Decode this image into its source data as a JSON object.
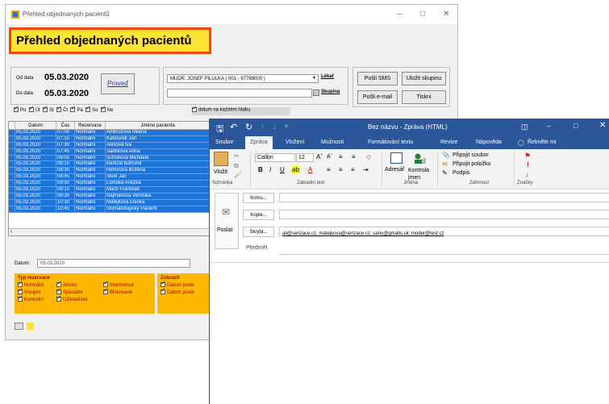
{
  "back_window": {
    "title": "Přehled objednaných pacientů",
    "heading": "Přehled objednaných pacientů",
    "od_data_label": "Od data",
    "od_data_value": "05.03.2020",
    "do_data_label": "Do data",
    "do_data_value": "05.03.2020",
    "proved_label": "Proveď",
    "doctor_value": "MUDR. JOSEF PILULKA ( 001 - 97789000 )",
    "lekar_label": "Lékař",
    "skupina_label": "Skupina",
    "posli_sms_label": "Pošli SMS",
    "ulozit_skupinu_label": "Uložit skupinu",
    "posli_email_label": "Pošli e-mail",
    "tisk_label": "Tiskni",
    "days": [
      "Po",
      "Út",
      "St",
      "Čt",
      "Pá",
      "So",
      "Ne"
    ],
    "datum_na_kazdem_label": "datum na každém řádku",
    "columns": [
      "Datum",
      "Čas",
      "Rezervace",
      "Jméno pacienta"
    ],
    "rows": [
      [
        "05.03.2020",
        "07:00",
        "Normální",
        "Ambrožová Milena"
      ],
      [
        "05.03.2020",
        "07:15",
        "Normální",
        "Kabourek Jan"
      ],
      [
        "05.03.2020",
        "07:30",
        "Normální",
        "Alexová Iva"
      ],
      [
        "05.03.2020",
        "07:45",
        "Normální",
        "Sadílková Anna"
      ],
      [
        "05.03.2020",
        "08:00",
        "Normální",
        "Schobová Michaela"
      ],
      [
        "05.03.2020",
        "08:15",
        "Normální",
        "Bartizal Bohumil"
      ],
      [
        "05.03.2020",
        "08:30",
        "Normální",
        "Řehořová Božena"
      ],
      [
        "05.03.2020",
        "08:45",
        "Normální",
        "Skok Jan"
      ],
      [
        "05.03.2020",
        "09:00",
        "Normální",
        "Lomoká Anežka"
      ],
      [
        "05.03.2020",
        "09:15",
        "Normální",
        "Mach František"
      ],
      [
        "05.03.2020",
        "09:30",
        "Normální",
        "Najmanová Veronika"
      ],
      [
        "05.03.2020",
        "10:30",
        "Normální",
        "Matějková Elenka"
      ],
      [
        "05.03.2020",
        "10:45",
        "Normální",
        "Stomatologický Pacient"
      ]
    ],
    "datum_label": "Datum:",
    "datum_value": "05.03.2020",
    "typ_rezervace_label": "Typ rezervace",
    "reservation_types": [
      [
        "Normální",
        "Akutní",
        "Internetové"
      ],
      [
        "Vstupní",
        "Speciální",
        "Blokované"
      ],
      [
        "Kontrolní",
        "Uživatelské",
        ""
      ]
    ],
    "zobrazit_label": "Zobrazit",
    "zobrazit_items": [
      "Datum posle",
      "Datum posle"
    ]
  },
  "outlook": {
    "title": "Bez názvu - Zpráva (HTML)",
    "tabs": [
      "Soubor",
      "Zpráva",
      "Vložení",
      "Možnosti",
      "Formátování textu",
      "Revize",
      "Nápověda",
      "Řekněte mi"
    ],
    "active_tab": "Zpráva",
    "clipboard": {
      "paste": "Vložit",
      "group": "Schránka"
    },
    "font": {
      "name": "Calibri",
      "size": "12",
      "group": "Základní text"
    },
    "names": {
      "address_book": "Adresář",
      "check_names": "Kontrola jmen",
      "group": "Jména"
    },
    "include": {
      "attach_file": "Připojit soubor",
      "attach_item": "Připojit položku",
      "signature": "Podpis",
      "group": "Zahrnout"
    },
    "tags": {
      "group": "Značky"
    },
    "send_label": "Poslat",
    "to_label": "Komu...",
    "cc_label": "Kopie...",
    "bcc_label": "Skrytá...",
    "subject_label": "Předmět",
    "bcc_value": "ali@senzace.cz; matejkova@senzace.cz; sano@gmatis.sk; moder@test.cz"
  },
  "colors": {
    "title_blue": "#2b579a",
    "row_blue": "#1e74d7",
    "heading_yellow": "#ffe333",
    "heading_border": "#f04a00",
    "legend_orange": "#ffb800"
  }
}
